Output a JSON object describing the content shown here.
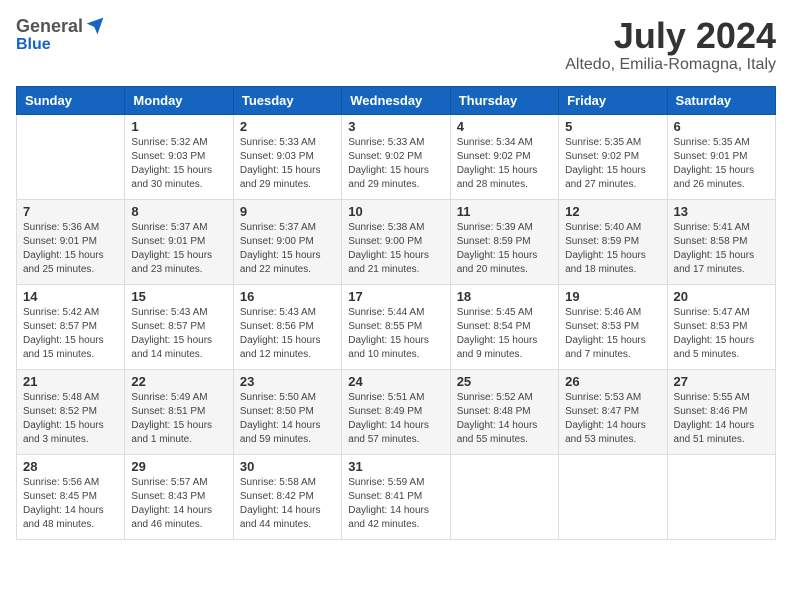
{
  "header": {
    "logo": {
      "general": "General",
      "blue": "Blue"
    },
    "title": "July 2024",
    "location": "Altedo, Emilia-Romagna, Italy"
  },
  "calendar": {
    "headers": [
      "Sunday",
      "Monday",
      "Tuesday",
      "Wednesday",
      "Thursday",
      "Friday",
      "Saturday"
    ],
    "weeks": [
      [
        {
          "day": "",
          "info": ""
        },
        {
          "day": "1",
          "info": "Sunrise: 5:32 AM\nSunset: 9:03 PM\nDaylight: 15 hours\nand 30 minutes."
        },
        {
          "day": "2",
          "info": "Sunrise: 5:33 AM\nSunset: 9:03 PM\nDaylight: 15 hours\nand 29 minutes."
        },
        {
          "day": "3",
          "info": "Sunrise: 5:33 AM\nSunset: 9:02 PM\nDaylight: 15 hours\nand 29 minutes."
        },
        {
          "day": "4",
          "info": "Sunrise: 5:34 AM\nSunset: 9:02 PM\nDaylight: 15 hours\nand 28 minutes."
        },
        {
          "day": "5",
          "info": "Sunrise: 5:35 AM\nSunset: 9:02 PM\nDaylight: 15 hours\nand 27 minutes."
        },
        {
          "day": "6",
          "info": "Sunrise: 5:35 AM\nSunset: 9:01 PM\nDaylight: 15 hours\nand 26 minutes."
        }
      ],
      [
        {
          "day": "7",
          "info": "Sunrise: 5:36 AM\nSunset: 9:01 PM\nDaylight: 15 hours\nand 25 minutes."
        },
        {
          "day": "8",
          "info": "Sunrise: 5:37 AM\nSunset: 9:01 PM\nDaylight: 15 hours\nand 23 minutes."
        },
        {
          "day": "9",
          "info": "Sunrise: 5:37 AM\nSunset: 9:00 PM\nDaylight: 15 hours\nand 22 minutes."
        },
        {
          "day": "10",
          "info": "Sunrise: 5:38 AM\nSunset: 9:00 PM\nDaylight: 15 hours\nand 21 minutes."
        },
        {
          "day": "11",
          "info": "Sunrise: 5:39 AM\nSunset: 8:59 PM\nDaylight: 15 hours\nand 20 minutes."
        },
        {
          "day": "12",
          "info": "Sunrise: 5:40 AM\nSunset: 8:59 PM\nDaylight: 15 hours\nand 18 minutes."
        },
        {
          "day": "13",
          "info": "Sunrise: 5:41 AM\nSunset: 8:58 PM\nDaylight: 15 hours\nand 17 minutes."
        }
      ],
      [
        {
          "day": "14",
          "info": "Sunrise: 5:42 AM\nSunset: 8:57 PM\nDaylight: 15 hours\nand 15 minutes."
        },
        {
          "day": "15",
          "info": "Sunrise: 5:43 AM\nSunset: 8:57 PM\nDaylight: 15 hours\nand 14 minutes."
        },
        {
          "day": "16",
          "info": "Sunrise: 5:43 AM\nSunset: 8:56 PM\nDaylight: 15 hours\nand 12 minutes."
        },
        {
          "day": "17",
          "info": "Sunrise: 5:44 AM\nSunset: 8:55 PM\nDaylight: 15 hours\nand 10 minutes."
        },
        {
          "day": "18",
          "info": "Sunrise: 5:45 AM\nSunset: 8:54 PM\nDaylight: 15 hours\nand 9 minutes."
        },
        {
          "day": "19",
          "info": "Sunrise: 5:46 AM\nSunset: 8:53 PM\nDaylight: 15 hours\nand 7 minutes."
        },
        {
          "day": "20",
          "info": "Sunrise: 5:47 AM\nSunset: 8:53 PM\nDaylight: 15 hours\nand 5 minutes."
        }
      ],
      [
        {
          "day": "21",
          "info": "Sunrise: 5:48 AM\nSunset: 8:52 PM\nDaylight: 15 hours\nand 3 minutes."
        },
        {
          "day": "22",
          "info": "Sunrise: 5:49 AM\nSunset: 8:51 PM\nDaylight: 15 hours\nand 1 minute."
        },
        {
          "day": "23",
          "info": "Sunrise: 5:50 AM\nSunset: 8:50 PM\nDaylight: 14 hours\nand 59 minutes."
        },
        {
          "day": "24",
          "info": "Sunrise: 5:51 AM\nSunset: 8:49 PM\nDaylight: 14 hours\nand 57 minutes."
        },
        {
          "day": "25",
          "info": "Sunrise: 5:52 AM\nSunset: 8:48 PM\nDaylight: 14 hours\nand 55 minutes."
        },
        {
          "day": "26",
          "info": "Sunrise: 5:53 AM\nSunset: 8:47 PM\nDaylight: 14 hours\nand 53 minutes."
        },
        {
          "day": "27",
          "info": "Sunrise: 5:55 AM\nSunset: 8:46 PM\nDaylight: 14 hours\nand 51 minutes."
        }
      ],
      [
        {
          "day": "28",
          "info": "Sunrise: 5:56 AM\nSunset: 8:45 PM\nDaylight: 14 hours\nand 48 minutes."
        },
        {
          "day": "29",
          "info": "Sunrise: 5:57 AM\nSunset: 8:43 PM\nDaylight: 14 hours\nand 46 minutes."
        },
        {
          "day": "30",
          "info": "Sunrise: 5:58 AM\nSunset: 8:42 PM\nDaylight: 14 hours\nand 44 minutes."
        },
        {
          "day": "31",
          "info": "Sunrise: 5:59 AM\nSunset: 8:41 PM\nDaylight: 14 hours\nand 42 minutes."
        },
        {
          "day": "",
          "info": ""
        },
        {
          "day": "",
          "info": ""
        },
        {
          "day": "",
          "info": ""
        }
      ]
    ]
  }
}
